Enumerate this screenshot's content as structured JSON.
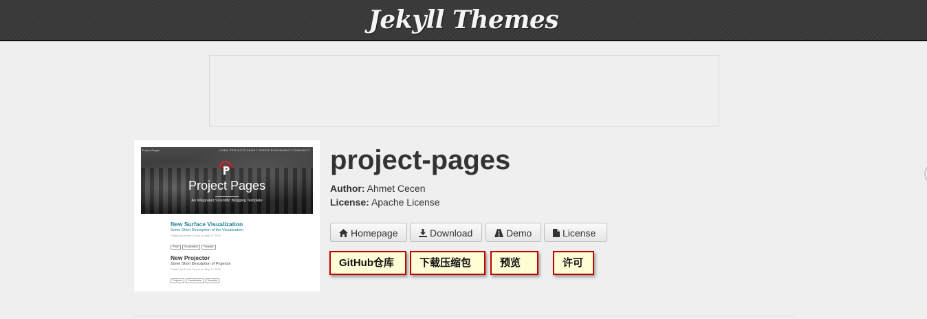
{
  "header": {
    "brand": "Jekyll Themes",
    "bg_color": "#3a3a3a"
  },
  "thumbnail": {
    "site_name": "Project Pages",
    "nav_links": "HOME   PROJECTS   ABOUT   VIDEOS   BOOKMARKS   COMMUNITY",
    "hero_title": "Project Pages",
    "hero_subtitle": "An Integrated Scientific Blogging Template",
    "posts": [
      {
        "title": "New Surface Visualization",
        "description": "Some Short Description of the Visualization",
        "meta": "Posted by Ahmet Cecen on May 17 2016",
        "tags": [
          "Plotly",
          "Visualization",
          "Template"
        ]
      },
      {
        "title": "New Projector",
        "description": "Some Short Description of Projector",
        "meta": "Posted by Ahmet Cecen on May 17 2016",
        "tags": [
          "Projector",
          "Visualization",
          "Template"
        ]
      }
    ]
  },
  "theme": {
    "name": "project-pages",
    "author_label": "Author:",
    "author": "Ahmet Cecen",
    "license_label": "License:",
    "license": "Apache License"
  },
  "buttons": [
    {
      "label": "Homepage",
      "icon": "home-icon"
    },
    {
      "label": "Download",
      "icon": "download-icon"
    },
    {
      "label": "Demo",
      "icon": "road-icon"
    },
    {
      "label": "License",
      "icon": "file-icon"
    }
  ],
  "notes": [
    "GitHub仓库",
    "下载压缩包",
    "预览",
    "许可"
  ],
  "colors": {
    "note_bg": "#fffdd5",
    "note_border": "#c00000",
    "teal": "#1b7f92"
  }
}
